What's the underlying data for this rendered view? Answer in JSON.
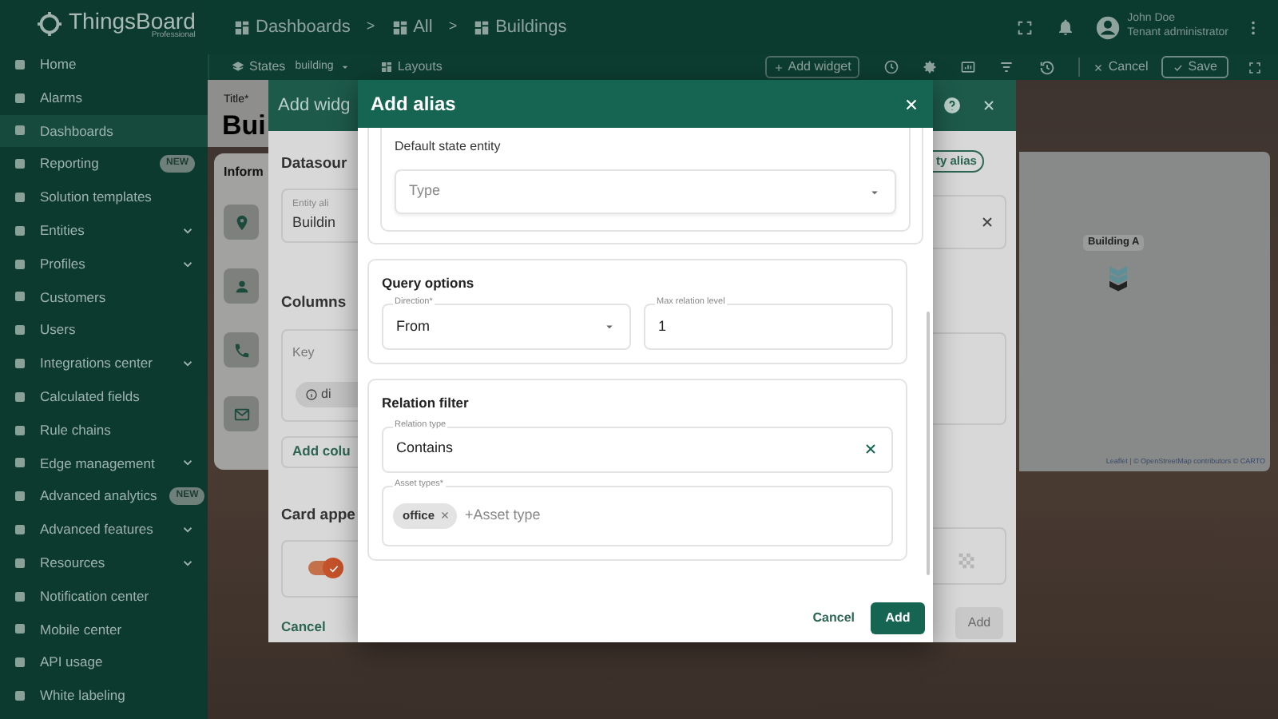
{
  "app": {
    "logo": "ThingsBoard",
    "logo_sub": "Professional"
  },
  "sidebar": {
    "items": [
      {
        "label": "Home",
        "selected": false,
        "expandable": false
      },
      {
        "label": "Alarms",
        "selected": false,
        "expandable": false
      },
      {
        "label": "Dashboards",
        "selected": true,
        "expandable": false
      },
      {
        "label": "Reporting",
        "selected": false,
        "expandable": false,
        "badge": "NEW"
      },
      {
        "label": "Solution templates",
        "selected": false,
        "expandable": false
      },
      {
        "label": "Entities",
        "selected": false,
        "expandable": true
      },
      {
        "label": "Profiles",
        "selected": false,
        "expandable": true
      },
      {
        "label": "Customers",
        "selected": false,
        "expandable": false
      },
      {
        "label": "Users",
        "selected": false,
        "expandable": false
      },
      {
        "label": "Integrations center",
        "selected": false,
        "expandable": true
      },
      {
        "label": "Calculated fields",
        "selected": false,
        "expandable": false
      },
      {
        "label": "Rule chains",
        "selected": false,
        "expandable": false
      },
      {
        "label": "Edge management",
        "selected": false,
        "expandable": true
      },
      {
        "label": "Advanced analytics",
        "selected": false,
        "expandable": false,
        "badge": "NEW"
      },
      {
        "label": "Advanced features",
        "selected": false,
        "expandable": true
      },
      {
        "label": "Resources",
        "selected": false,
        "expandable": true
      },
      {
        "label": "Notification center",
        "selected": false,
        "expandable": false
      },
      {
        "label": "Mobile center",
        "selected": false,
        "expandable": false
      },
      {
        "label": "API usage",
        "selected": false,
        "expandable": false
      },
      {
        "label": "White labeling",
        "selected": false,
        "expandable": false
      }
    ]
  },
  "breadcrumbs": {
    "separator": ">",
    "items": [
      "Dashboards",
      "All",
      "Buildings"
    ]
  },
  "user": {
    "name": "John Doe",
    "role": "Tenant administrator"
  },
  "toolbar": {
    "states_label": "States",
    "state": "building",
    "layouts": "Layouts",
    "add_widget": "Add widget",
    "cancel": "Cancel",
    "save": "Save"
  },
  "dashboard": {
    "title_label": "Title*",
    "title": "Bui",
    "card_title": "Inform"
  },
  "map": {
    "marker_label": "Building A",
    "attribution": "Leaflet | © OpenStreetMap contributors © CARTO"
  },
  "widget_dialog": {
    "title": "Add widg",
    "datasource": "Datasour",
    "entity_alias_label": "Entity ali",
    "entity_alias": "Buildin",
    "alias_button": "ty alias",
    "columns": "Columns",
    "key_label": "Key",
    "key_chip": "di",
    "add_column": "Add colu",
    "card_appearance": "Card appe",
    "toggle_on": true,
    "cancel": "Cancel",
    "add": "Add",
    "add_disabled": true
  },
  "alias_dialog": {
    "title": "Add alias",
    "default_state": {
      "title": "Default state entity",
      "type_placeholder": "Type"
    },
    "query_options": {
      "title": "Query options",
      "direction_label": "Direction*",
      "direction": "From",
      "max_level_label": "Max relation level",
      "max_level": "1"
    },
    "relation_filter": {
      "title": "Relation filter",
      "relation_type_label": "Relation type",
      "relation_type": "Contains",
      "asset_types_label": "Asset types*",
      "asset_types": [
        "office"
      ],
      "asset_type_placeholder": "+Asset type"
    },
    "buttons": {
      "cancel": "Cancel",
      "add": "Add"
    }
  }
}
